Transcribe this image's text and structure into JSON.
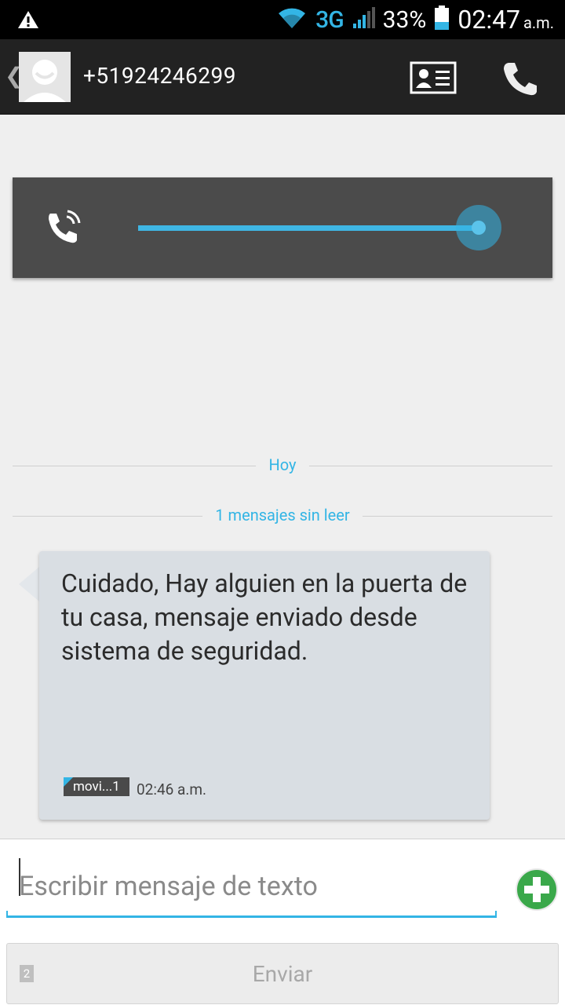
{
  "statusbar": {
    "network": "3G",
    "battery": "33%",
    "time": "02:47",
    "ampm": "a.m."
  },
  "actionbar": {
    "title": "+51924246299"
  },
  "call_card": {
    "progress": 1.0
  },
  "dividers": {
    "today": "Hoy",
    "unread": "1 mensajes sin leer"
  },
  "message": {
    "text": "Cuidado, Hay alguien en la puerta de tu casa, mensaje enviado desde sistema de seguridad.",
    "sim": "movi...1",
    "time": "02:46 a.m."
  },
  "compose": {
    "placeholder": "Escribir mensaje de texto",
    "send": "Enviar",
    "sim_slot": "2"
  },
  "colors": {
    "accent": "#33b5e5",
    "add": "#3aa84a"
  }
}
